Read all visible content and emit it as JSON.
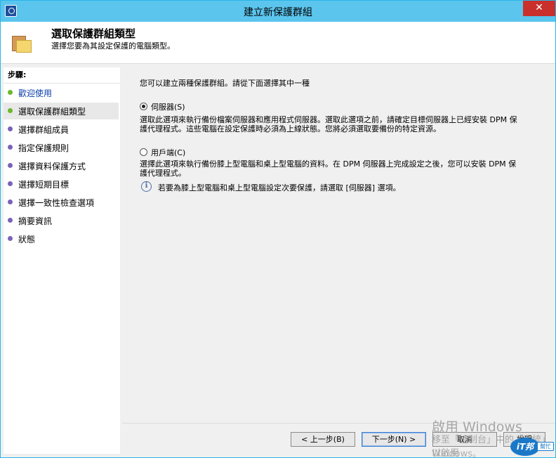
{
  "window": {
    "title": "建立新保護群組",
    "close_glyph": "✕",
    "icon": "dpm-app-icon"
  },
  "header": {
    "title": "選取保護群組類型",
    "subtitle": "選擇您要為其設定保護的電腦類型。",
    "icon": "folder-icon"
  },
  "sidebar": {
    "steps_label": "步驟:",
    "steps": [
      {
        "label": "歡迎使用",
        "status": "done"
      },
      {
        "label": "選取保護群組類型",
        "status": "current"
      },
      {
        "label": "選擇群組成員",
        "status": "pending"
      },
      {
        "label": "指定保護規則",
        "status": "pending"
      },
      {
        "label": "選擇資料保護方式",
        "status": "pending"
      },
      {
        "label": "選擇短期目標",
        "status": "pending"
      },
      {
        "label": "選擇一致性檢查選項",
        "status": "pending"
      },
      {
        "label": "摘要資訊",
        "status": "pending"
      },
      {
        "label": "狀態",
        "status": "pending"
      }
    ]
  },
  "content": {
    "intro": "您可以建立兩種保護群組。請從下面選擇其中一種",
    "options": [
      {
        "label": "伺服器(S)",
        "checked": true,
        "description_line1": "選取此選項來執行備份檔案伺服器和應用程式伺服器。選取此選項之前，請確定目標伺服器上已經安裝 DPM 保",
        "description_line2": "護代理程式。這些電腦在設定保護時必須為上線狀態。您將必須選取要備份的特定資源。"
      },
      {
        "label": "用戶端(C)",
        "checked": false,
        "description_line1": "選擇此選項來執行備份膝上型電腦和桌上型電腦的資料。在 DPM 伺服器上完成設定之後，您可以安裝 DPM 保",
        "description_line2": "護代理程式。"
      }
    ],
    "info_text": "若要為膝上型電腦和桌上型電腦設定次要保護，請選取 [伺服器] 選項。"
  },
  "buttons": {
    "back": "< 上一步(B)",
    "next": "下一步(N) >",
    "cancel": "取消",
    "help": "說明"
  },
  "watermark": {
    "line1": "啟用 Windows",
    "line2": "移至「控制台」中的「系統」以啟用",
    "line3": "Windows。"
  },
  "logo": {
    "main": "iT邦",
    "tag": "幫忙"
  }
}
